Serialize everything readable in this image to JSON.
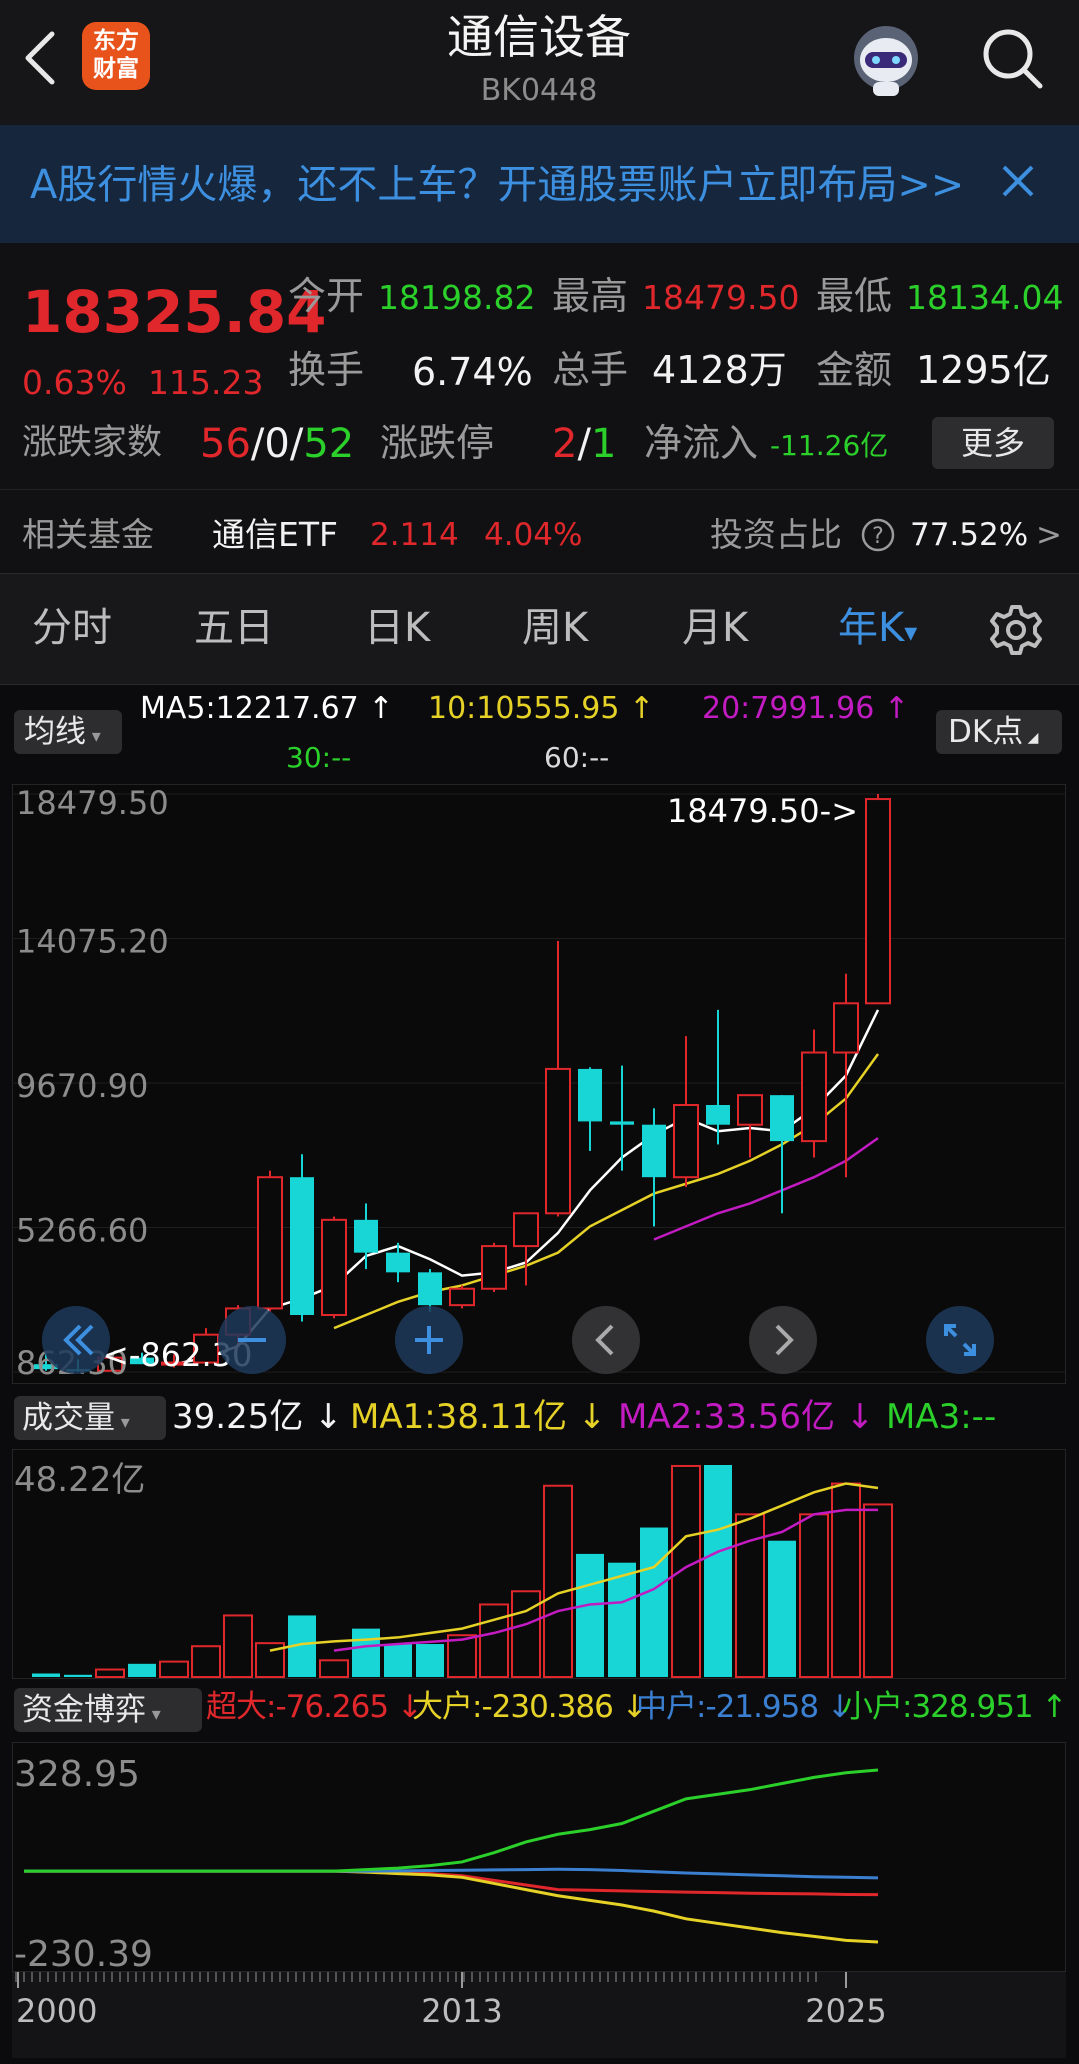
{
  "header": {
    "title": "通信设备",
    "code": "BK0448",
    "logo_line1": "东方",
    "logo_line2": "财富"
  },
  "banner": {
    "text": "A股行情火爆，还不上车？开通股票账户立即布局>>"
  },
  "quote": {
    "price": "18325.84",
    "change_pct": "0.63%",
    "change": "115.23",
    "open_label": "今开",
    "open": "18198.82",
    "high_label": "最高",
    "high": "18479.50",
    "low_label": "最低",
    "low": "18134.04",
    "turnover_label": "换手",
    "turnover": "6.74%",
    "volume_label": "总手",
    "volume": "4128万",
    "amount_label": "金额",
    "amount": "1295亿",
    "breadth_label": "涨跌家数",
    "up": "56",
    "sep1": "/",
    "flat": "0",
    "sep2": "/",
    "down": "52",
    "limit_label": "涨跌停",
    "limit_up": "2",
    "sep3": "/",
    "limit_down": "1",
    "inflow_label": "净流入",
    "inflow": "-11.26亿",
    "more_button": "更多",
    "fund_label": "相关基金",
    "fund_name": "通信ETF",
    "fund_price": "2.114",
    "fund_pct": "4.04%",
    "ratio_label": "投资占比",
    "ratio": "77.52%",
    "ratio_arrow": ">"
  },
  "tabs": {
    "items": [
      "分时",
      "五日",
      "日K",
      "周K",
      "月K",
      "年K"
    ],
    "active": "年K",
    "dropdown_arrow": "▾"
  },
  "indicators": {
    "ma_select": "均线",
    "ma5": "MA5:12217.67 ↑",
    "ma10": "10:10555.95 ↑",
    "ma20": "20:7991.96 ↑",
    "ma30": "30:--",
    "ma60": "60:--",
    "dk_button": "DK点",
    "vol_select": "成交量",
    "vol_value": "39.25亿 ↓",
    "vol_ma1": "MA1:38.11亿 ↓",
    "vol_ma2": "MA2:33.56亿 ↓",
    "vol_ma3": "MA3:--",
    "fund_select": "资金博弈",
    "super": "超大:-76.265 ↓",
    "large": "大户:-230.386 ↓",
    "mid": "中户:-21.958 ↓",
    "small": "小户:328.951 ↑"
  },
  "colors": {
    "up": "#e0272b",
    "down": "#18d6d6",
    "ma5": "#ffffff",
    "ma10": "#e6d227",
    "ma20": "#c21bc2",
    "green": "#2bd02b",
    "blue": "#3b7fd1",
    "accent": "#3d8fe0"
  },
  "chart_data": [
    {
      "type": "candlestick",
      "y_ticks": [
        "18479.50",
        "14075.20",
        "9670.90",
        "5266.60",
        "862.30"
      ],
      "high_marker": "18479.50->",
      "low_marker": "<-862.30",
      "candles": [
        {
          "o": 1100,
          "h": 1500,
          "l": 900,
          "c": 950
        },
        {
          "o": 950,
          "h": 1250,
          "l": 862,
          "c": 900
        },
        {
          "o": 900,
          "h": 1350,
          "l": 880,
          "c": 1300
        },
        {
          "o": 1300,
          "h": 1450,
          "l": 1200,
          "c": 1100
        },
        {
          "o": 1100,
          "h": 1400,
          "l": 1000,
          "c": 1150
        },
        {
          "o": 1150,
          "h": 2200,
          "l": 1100,
          "c": 2000
        },
        {
          "o": 2000,
          "h": 2900,
          "l": 1600,
          "c": 2800
        },
        {
          "o": 2800,
          "h": 7000,
          "l": 2700,
          "c": 6800
        },
        {
          "o": 6800,
          "h": 7500,
          "l": 2400,
          "c": 2600
        },
        {
          "o": 2600,
          "h": 5600,
          "l": 2500,
          "c": 5500
        },
        {
          "o": 5500,
          "h": 6000,
          "l": 4000,
          "c": 4500
        },
        {
          "o": 4500,
          "h": 4800,
          "l": 3600,
          "c": 3900
        },
        {
          "o": 3900,
          "h": 4000,
          "l": 2700,
          "c": 2900
        },
        {
          "o": 2900,
          "h": 3500,
          "l": 2800,
          "c": 3400
        },
        {
          "o": 3400,
          "h": 4800,
          "l": 3300,
          "c": 4700
        },
        {
          "o": 4700,
          "h": 5700,
          "l": 3500,
          "c": 5700
        },
        {
          "o": 5700,
          "h": 14000,
          "l": 5600,
          "c": 10100
        },
        {
          "o": 10100,
          "h": 10150,
          "l": 7600,
          "c": 8500
        },
        {
          "o": 8500,
          "h": 10200,
          "l": 7000,
          "c": 8400
        },
        {
          "o": 8400,
          "h": 8900,
          "l": 5300,
          "c": 6800
        },
        {
          "o": 6800,
          "h": 11100,
          "l": 6500,
          "c": 9000
        },
        {
          "o": 9000,
          "h": 11900,
          "l": 7800,
          "c": 8400
        },
        {
          "o": 8400,
          "h": 9300,
          "l": 7400,
          "c": 9300
        },
        {
          "o": 9300,
          "h": 9300,
          "l": 5700,
          "c": 7900
        },
        {
          "o": 7900,
          "h": 11300,
          "l": 7400,
          "c": 10600
        },
        {
          "o": 10600,
          "h": 13000,
          "l": 6800,
          "c": 12100
        },
        {
          "o": 12100,
          "h": 18479.5,
          "l": 12100,
          "c": 18325.84
        }
      ],
      "ma5": [
        null,
        null,
        null,
        null,
        1100,
        1300,
        1650,
        2800,
        3100,
        3500,
        4400,
        4700,
        4300,
        3800,
        3900,
        4200,
        5100,
        6400,
        7400,
        8100,
        8600,
        8200,
        8300,
        8200,
        8900,
        9900,
        11900
      ],
      "ma10": [
        null,
        null,
        null,
        null,
        null,
        null,
        null,
        null,
        null,
        2200,
        2600,
        3000,
        3300,
        3500,
        3800,
        4100,
        4500,
        5300,
        5800,
        6300,
        6600,
        6900,
        7300,
        7800,
        8400,
        9200,
        10555.95
      ],
      "ma20": [
        null,
        null,
        null,
        null,
        null,
        null,
        null,
        null,
        null,
        null,
        null,
        null,
        null,
        null,
        null,
        null,
        null,
        null,
        null,
        4900,
        5300,
        5700,
        6000,
        6400,
        6800,
        7300,
        7991.96
      ]
    },
    {
      "type": "bar",
      "y_ticks": [
        "48.22亿"
      ],
      "unit": "亿",
      "values": [
        0.8,
        0.5,
        1.7,
        3.0,
        3.5,
        7.0,
        14.0,
        7.7,
        14.0,
        3.8,
        11.0,
        7.5,
        7.5,
        9.5,
        16.5,
        19.5,
        43.5,
        28.0,
        26.0,
        34.0,
        48.0,
        48.22,
        37.0,
        31.0,
        37.0,
        44.0,
        39.25
      ],
      "ma1": [
        null,
        null,
        null,
        null,
        null,
        null,
        null,
        6.0,
        7.5,
        8.1,
        8.5,
        9.0,
        10.0,
        11.0,
        13.0,
        15.0,
        19.0,
        21.0,
        23.0,
        25.0,
        32.0,
        33.5,
        36.0,
        39.0,
        42.0,
        44.0,
        43.0
      ],
      "ma2": [
        null,
        null,
        null,
        null,
        null,
        null,
        null,
        null,
        null,
        6.0,
        7.0,
        7.5,
        8.0,
        8.5,
        10.0,
        12.0,
        15.0,
        16.5,
        17.0,
        20.0,
        25.0,
        28.5,
        31.0,
        33.0,
        37.0,
        38.0,
        38.0
      ]
    },
    {
      "type": "line",
      "y_ticks": [
        "328.95",
        "-230.39"
      ],
      "x_ticks": [
        "2000",
        "2013",
        "2025"
      ],
      "series": [
        {
          "name": "超大",
          "values": [
            0,
            0,
            0,
            0,
            0,
            0,
            0,
            0,
            0,
            0,
            -2,
            -5,
            -8,
            -15,
            -30,
            -45,
            -60,
            -62,
            -64,
            -66,
            -68,
            -70,
            -72,
            -73,
            -74,
            -76,
            -76.265
          ]
        },
        {
          "name": "大户",
          "values": [
            0,
            0,
            0,
            0,
            0,
            0,
            0,
            0,
            0,
            0,
            -3,
            -8,
            -12,
            -20,
            -40,
            -60,
            -80,
            -95,
            -110,
            -130,
            -155,
            -170,
            -185,
            -200,
            -212,
            -225,
            -230.386
          ]
        },
        {
          "name": "中户",
          "values": [
            0,
            0,
            0,
            0,
            0,
            0,
            0,
            0,
            0,
            0,
            0,
            1,
            2,
            3,
            4,
            5,
            6,
            5,
            2,
            -2,
            -6,
            -9,
            -12,
            -15,
            -18,
            -20,
            -21.958
          ]
        },
        {
          "name": "小户",
          "values": [
            0,
            0,
            0,
            0,
            0,
            0,
            0,
            0,
            0,
            0,
            5,
            10,
            18,
            30,
            60,
            95,
            120,
            135,
            155,
            195,
            235,
            250,
            265,
            285,
            305,
            320,
            328.951
          ]
        }
      ]
    }
  ]
}
